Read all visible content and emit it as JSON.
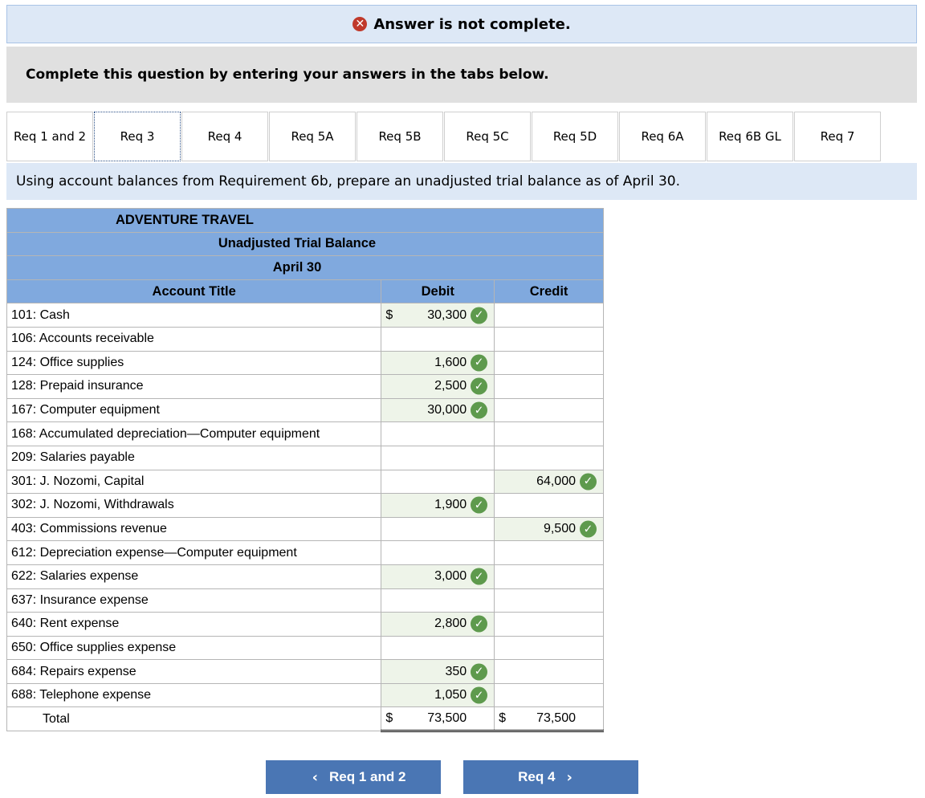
{
  "banner": {
    "text": "Answer is not complete.",
    "icon": "x-circle-icon"
  },
  "instruction": "Complete this question by entering your answers in the tabs below.",
  "tabs": [
    {
      "label": "Req 1 and 2"
    },
    {
      "label": "Req 3",
      "active": true
    },
    {
      "label": "Req 4"
    },
    {
      "label": "Req 5A"
    },
    {
      "label": "Req 5B"
    },
    {
      "label": "Req 5C"
    },
    {
      "label": "Req 5D"
    },
    {
      "label": "Req 6A"
    },
    {
      "label": "Req 6B GL"
    },
    {
      "label": "Req 7"
    }
  ],
  "prompt": "Using account balances from Requirement 6b, prepare an unadjusted trial balance as of April 30.",
  "table": {
    "company": "ADVENTURE TRAVEL",
    "title": "Unadjusted Trial Balance",
    "date": "April 30",
    "col_account": "Account Title",
    "col_debit": "Debit",
    "col_credit": "Credit",
    "rows": [
      {
        "account": "101: Cash",
        "debit": "30,300",
        "credit": "",
        "debit_dollar": "$"
      },
      {
        "account": "106: Accounts receivable",
        "debit": "",
        "credit": ""
      },
      {
        "account": "124: Office supplies",
        "debit": "1,600",
        "credit": ""
      },
      {
        "account": "128: Prepaid insurance",
        "debit": "2,500",
        "credit": ""
      },
      {
        "account": "167: Computer equipment",
        "debit": "30,000",
        "credit": ""
      },
      {
        "account": "168: Accumulated depreciation—Computer equipment",
        "debit": "",
        "credit": ""
      },
      {
        "account": "209: Salaries payable",
        "debit": "",
        "credit": ""
      },
      {
        "account": "301: J. Nozomi, Capital",
        "debit": "",
        "credit": "64,000"
      },
      {
        "account": "302: J. Nozomi, Withdrawals",
        "debit": "1,900",
        "credit": ""
      },
      {
        "account": "403: Commissions revenue",
        "debit": "",
        "credit": "9,500"
      },
      {
        "account": "612: Depreciation expense—Computer equipment",
        "debit": "",
        "credit": ""
      },
      {
        "account": "622: Salaries expense",
        "debit": "3,000",
        "credit": ""
      },
      {
        "account": "637: Insurance expense",
        "debit": "",
        "credit": ""
      },
      {
        "account": "640: Rent expense",
        "debit": "2,800",
        "credit": ""
      },
      {
        "account": "650: Office supplies expense",
        "debit": "",
        "credit": ""
      },
      {
        "account": "684: Repairs expense",
        "debit": "350",
        "credit": ""
      },
      {
        "account": "688: Telephone expense",
        "debit": "1,050",
        "credit": ""
      }
    ],
    "total": {
      "label": "Total",
      "debit_dollar": "$",
      "debit": "73,500",
      "credit_dollar": "$",
      "credit": "73,500"
    }
  },
  "nav": {
    "prev_label": "Req 1 and 2",
    "next_label": "Req 4",
    "prev_icon": "chevron-left-icon",
    "next_icon": "chevron-right-icon"
  },
  "colors": {
    "header_blue": "#80a9de",
    "button_blue": "#4a76b4",
    "check_green": "#5e9a4d",
    "error_red": "#c0392b"
  }
}
